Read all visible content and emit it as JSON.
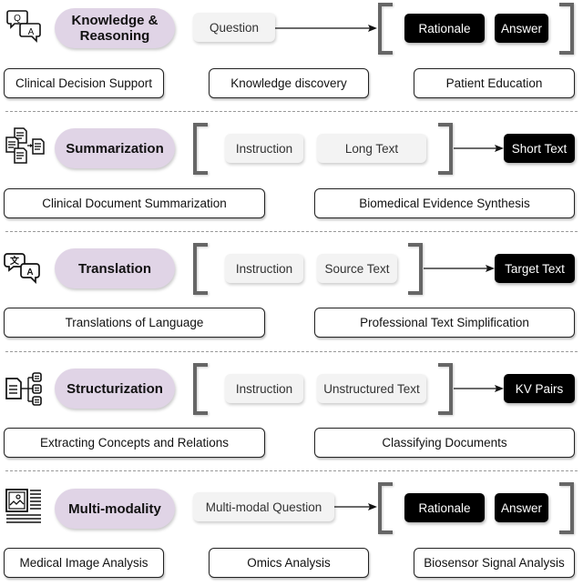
{
  "rows": [
    {
      "id": "knowledge-reasoning",
      "icon": "qa-chat-icon",
      "task_label": "Knowledge & Reasoning",
      "task_line1": "Knowledge &",
      "task_line2": "Reasoning",
      "inputs": [
        "Question"
      ],
      "outputs": [
        "Rationale",
        "Answer"
      ],
      "applications": [
        "Clinical Decision Support",
        "Knowledge discovery",
        "Patient Education"
      ]
    },
    {
      "id": "summarization",
      "icon": "documents-summarize-icon",
      "task_label": "Summarization",
      "inputs": [
        "Instruction",
        "Long Text"
      ],
      "outputs": [
        "Short Text"
      ],
      "applications": [
        "Clinical Document Summarization",
        "Biomedical Evidence Synthesis"
      ]
    },
    {
      "id": "translation",
      "icon": "translate-icon",
      "task_label": "Translation",
      "inputs": [
        "Instruction",
        "Source Text"
      ],
      "outputs": [
        "Target Text"
      ],
      "applications": [
        "Translations of Language",
        "Professional Text Simplification"
      ]
    },
    {
      "id": "structurization",
      "icon": "document-tree-icon",
      "task_label": "Structurization",
      "inputs": [
        "Instruction",
        "Unstructured Text"
      ],
      "outputs": [
        "KV Pairs"
      ],
      "applications": [
        "Extracting Concepts and Relations",
        "Classifying Documents"
      ]
    },
    {
      "id": "multi-modality",
      "icon": "image-document-icon",
      "task_label": "Multi-modality",
      "inputs": [
        "Multi-modal Question"
      ],
      "outputs": [
        "Rationale",
        "Answer"
      ],
      "applications": [
        "Medical Image Analysis",
        "Omics Analysis",
        "Biosensor Signal Analysis"
      ]
    }
  ],
  "colors": {
    "task_pill": "#e0d4e6",
    "input_box": "#f3f3f3",
    "output_box": "#000000",
    "bracket": "#666666",
    "divider": "#999999"
  }
}
